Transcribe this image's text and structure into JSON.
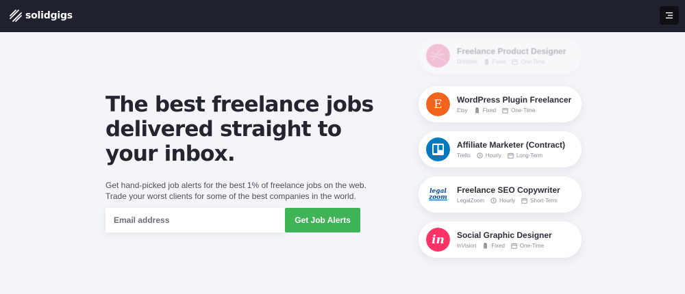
{
  "header": {
    "brand": "solidgigs",
    "colors": {
      "bar": "#1f222e",
      "menu_button": "#0e1016"
    }
  },
  "hero": {
    "title": "The best freelance jobs delivered straight to your inbox.",
    "subtitle": "Get hand-picked job alerts for the best 1% of freelance jobs on the web. Trade your worst clients for some of the best companies in the world.",
    "email_placeholder": "Email address",
    "cta_label": "Get Job Alerts",
    "cta_color": "#3fb456"
  },
  "jobs": [
    {
      "title": "Freelance Product Designer",
      "company": "Dribbble",
      "pay": "Fixed",
      "pay_icon": "clipboard-icon",
      "duration": "One-Time",
      "logo_color": "#ea4c89",
      "logo_text": ""
    },
    {
      "title": "WordPress Plugin Freelancer",
      "company": "Etsy",
      "pay": "Fixed",
      "pay_icon": "clipboard-icon",
      "duration": "One-Time",
      "logo_color": "#f1641e",
      "logo_text": "E"
    },
    {
      "title": "Affiliate Marketer (Contract)",
      "company": "Trello",
      "pay": "Hourly",
      "pay_icon": "clock-icon",
      "duration": "Long-Term",
      "logo_color": "#0079bf",
      "logo_text": ""
    },
    {
      "title": "Freelance SEO Copywriter",
      "company": "LegalZoom",
      "pay": "Hourly",
      "pay_icon": "clock-icon",
      "duration": "Short-Term",
      "logo_color": "#0d4aa8",
      "logo_text": "legal zoom"
    },
    {
      "title": "Social Graphic Designer",
      "company": "InVision",
      "pay": "Fixed",
      "pay_icon": "clipboard-icon",
      "duration": "One-Time",
      "logo_color": "#ff3366",
      "logo_text": "in"
    }
  ]
}
